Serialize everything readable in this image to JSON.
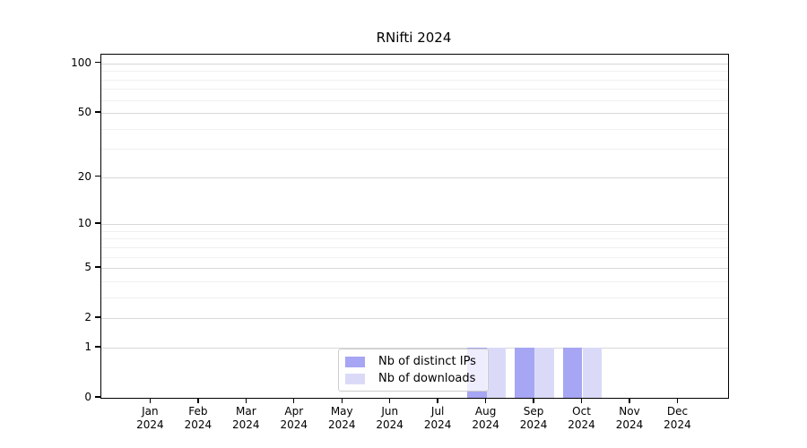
{
  "chart_data": {
    "type": "bar",
    "title": "RNifti 2024",
    "categories": [
      "Jan",
      "Feb",
      "Mar",
      "Apr",
      "May",
      "Jun",
      "Jul",
      "Aug",
      "Sep",
      "Oct",
      "Nov",
      "Dec"
    ],
    "category_year": "2024",
    "series": [
      {
        "name": "Nb of distinct IPs",
        "color": "#a6a6f4",
        "values": [
          0,
          0,
          0,
          0,
          0,
          0,
          0,
          1,
          1,
          1,
          0,
          0
        ]
      },
      {
        "name": "Nb of downloads",
        "color": "#dadaf8",
        "values": [
          0,
          0,
          0,
          0,
          0,
          0,
          0,
          1,
          1,
          1,
          0,
          0
        ]
      }
    ],
    "y_axis": {
      "scale": "log1p",
      "ticks": [
        0,
        1,
        2,
        5,
        10,
        20,
        50,
        100
      ],
      "minor_gridlines": [
        3,
        4,
        6,
        7,
        8,
        9,
        30,
        40,
        60,
        70,
        80,
        90
      ],
      "max": 113
    },
    "xlabel": "",
    "ylabel": "",
    "grid": true,
    "legend_position": "bottom-center",
    "colors": {
      "axis": "#000000",
      "grid_major": "#d8d8d8",
      "grid_minor": "#f0f0f0",
      "legend_border": "#cccccc",
      "background": "#ffffff"
    }
  }
}
